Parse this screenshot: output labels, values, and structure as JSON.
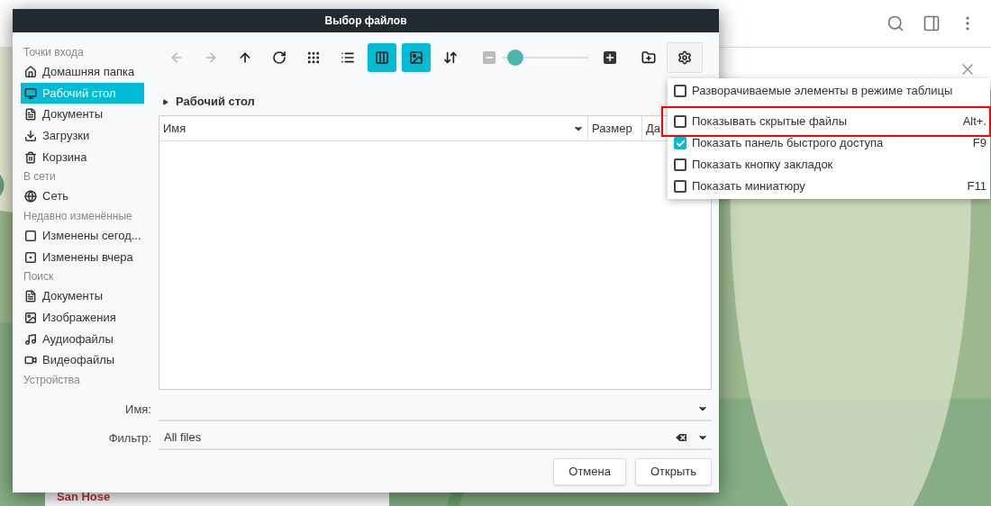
{
  "background": {
    "side_text": "San Hose"
  },
  "dialog": {
    "title": "Выбор файлов",
    "sidebar": [
      {
        "kind": "header",
        "label": "Точки входа"
      },
      {
        "kind": "item",
        "label": "Домашняя папка",
        "selected": false
      },
      {
        "kind": "item",
        "label": "Рабочий стол",
        "selected": true
      },
      {
        "kind": "item",
        "label": "Документы",
        "selected": false
      },
      {
        "kind": "item",
        "label": "Загрузки",
        "selected": false
      },
      {
        "kind": "item",
        "label": "Корзина",
        "selected": false
      },
      {
        "kind": "header",
        "label": "В сети"
      },
      {
        "kind": "item",
        "label": "Сеть",
        "selected": false
      },
      {
        "kind": "header",
        "label": "Недавно изменённые"
      },
      {
        "kind": "item",
        "label": "Изменены сегод...",
        "selected": false
      },
      {
        "kind": "item",
        "label": "Изменены вчера",
        "selected": false
      },
      {
        "kind": "header",
        "label": "Поиск"
      },
      {
        "kind": "item",
        "label": "Документы",
        "selected": false
      },
      {
        "kind": "item",
        "label": "Изображения",
        "selected": false
      },
      {
        "kind": "item",
        "label": "Аудиофайлы",
        "selected": false
      },
      {
        "kind": "item",
        "label": "Видеофайлы",
        "selected": false
      },
      {
        "kind": "header",
        "label": "Устройства"
      }
    ],
    "toolbar": [
      {
        "disabled": true,
        "selected": false
      },
      {
        "disabled": true,
        "selected": false
      },
      {
        "disabled": false,
        "selected": false
      },
      {
        "disabled": false,
        "selected": false
      },
      {
        "disabled": false,
        "selected": false
      },
      {
        "disabled": false,
        "selected": false
      },
      {
        "disabled": false,
        "selected": true
      },
      {
        "disabled": false,
        "selected": true
      },
      {
        "disabled": false,
        "selected": false
      }
    ],
    "zoom": {
      "level": 0.15
    },
    "path": "Рабочий стол",
    "columns": [
      "Имя",
      "Размер",
      "Да"
    ],
    "name_label": "Имя:",
    "filter_label": "Фильтр:",
    "filter_value": "All files",
    "buttons": [
      "Отмена",
      "Открыть"
    ]
  },
  "menu": [
    {
      "label": "Разворачиваемые элементы в режиме таблицы",
      "checked": false,
      "highlighted": false
    },
    {
      "label": "Показывать скрытые файлы",
      "shortcut": "Alt+.",
      "checked": false,
      "highlighted": true
    },
    {
      "label": "Показать панель быстрого доступа",
      "shortcut": "F9",
      "checked": true,
      "highlighted": false
    },
    {
      "label": "Показать кнопку закладок",
      "checked": false,
      "highlighted": false
    },
    {
      "label": "Показать миниатюру",
      "shortcut": "F11",
      "checked": false,
      "highlighted": false
    }
  ]
}
